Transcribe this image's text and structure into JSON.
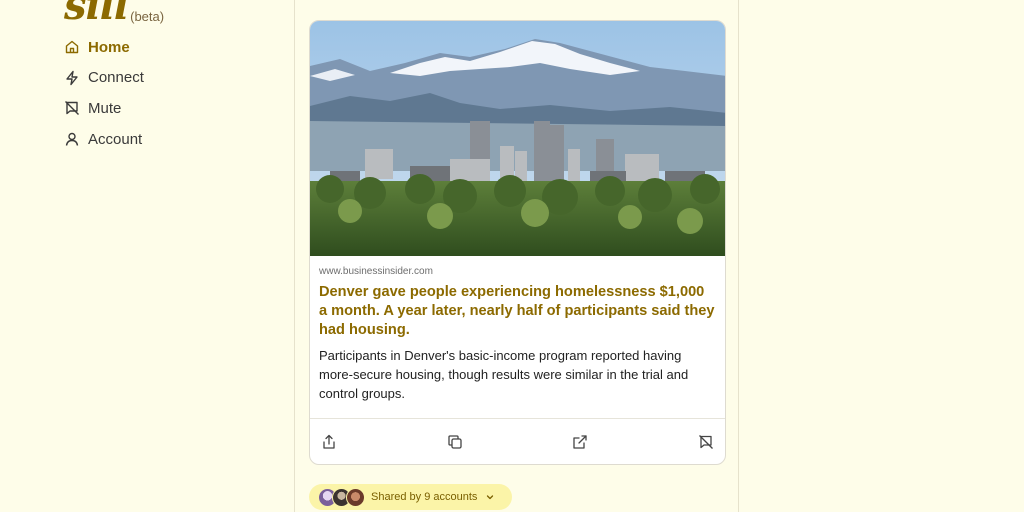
{
  "brand": {
    "name": "sill",
    "tag": "(beta)"
  },
  "nav": {
    "items": [
      {
        "label": "Home",
        "icon": "home-icon",
        "active": true
      },
      {
        "label": "Connect",
        "icon": "lightning-icon",
        "active": false
      },
      {
        "label": "Mute",
        "icon": "mute-icon",
        "active": false
      },
      {
        "label": "Account",
        "icon": "user-icon",
        "active": false
      }
    ]
  },
  "post": {
    "domain": "www.businessinsider.com",
    "headline": "Denver gave people experiencing homelessness $1,000 a month. A year later, nearly half of participants said they had housing.",
    "description": "Participants in Denver's basic-income program reported having more-secure housing, though results were similar in the trial and control groups.",
    "actions": [
      "share-icon",
      "copy-icon",
      "open-external-icon",
      "mute-icon"
    ]
  },
  "shared": {
    "label": "Shared by 9 accounts"
  },
  "colors": {
    "background": "#fefde9",
    "accent": "#8c6a00",
    "shared_pill": "#fbf4a8"
  }
}
